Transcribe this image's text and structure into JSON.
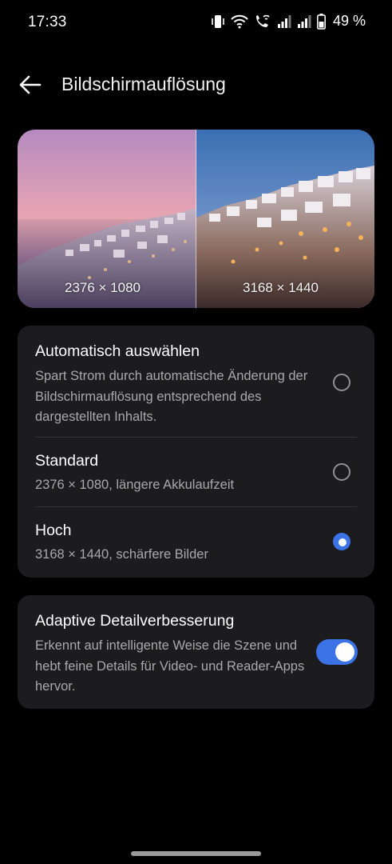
{
  "status_bar": {
    "time": "17:33",
    "battery_percent": "49 %",
    "icons": [
      "vibrate-icon",
      "wifi-icon",
      "wifi-calling-icon",
      "signal-icon",
      "signal-icon",
      "battery-icon"
    ]
  },
  "header": {
    "back_icon": "arrow-left-icon",
    "title": "Bildschirmauflösung"
  },
  "preview": {
    "left_resolution": "2376 × 1080",
    "right_resolution": "3168 × 1440"
  },
  "resolution_options": [
    {
      "title": "Automatisch auswählen",
      "description": "Spart Strom durch automatische Änderung der Bildschirmauflösung entsprechend des dargestellten Inhalts.",
      "selected": false
    },
    {
      "title": "Standard",
      "description": "2376 × 1080, längere Akkulaufzeit",
      "selected": false
    },
    {
      "title": "Hoch",
      "description": "3168 × 1440, schärfere Bilder",
      "selected": true
    }
  ],
  "adaptive": {
    "title": "Adaptive Detailverbesserung",
    "description": "Erkennt auf intelligente Weise die Szene und hebt feine Details für Video- und Reader-Apps hervor.",
    "enabled": true
  },
  "colors": {
    "accent": "#3b73e7",
    "card_background": "#1c1c1e",
    "secondary_text": "#a9a9ad"
  }
}
